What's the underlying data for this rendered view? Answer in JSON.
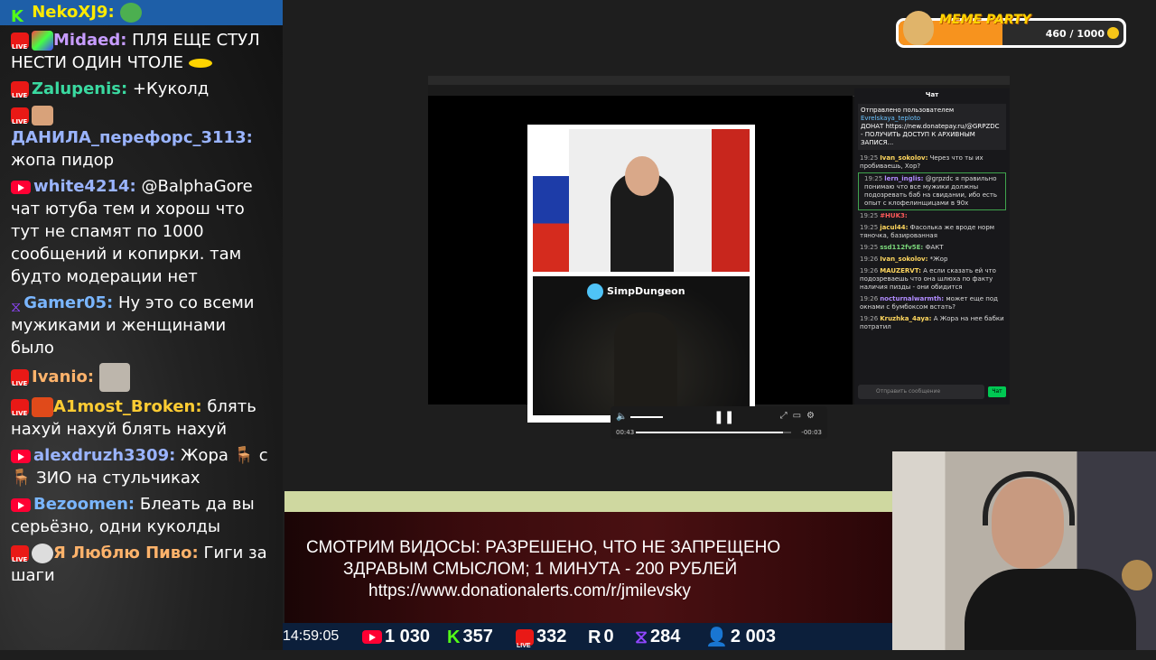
{
  "chat": {
    "top_name": "NekoXJ9:",
    "messages": [
      {
        "name": "Midaed:",
        "text": "ПЛЯ ЕЩЕ СТУЛ НЕСТИ ОДИН ЧТОЛЕ",
        "color": "#c79cff",
        "badge": "live"
      },
      {
        "name": "Zalupenis:",
        "text": "+Куколд",
        "color": "#3ad9a0",
        "badge": "live"
      },
      {
        "name": "ДАНИЛА_перефорс_3113:",
        "text": "жопа пидор",
        "color": "#9ab4ff",
        "badge": "live"
      },
      {
        "name": "white4214:",
        "text": "@BalphaGore чат ютуба тем и хорош что тут не спамят по 1000 сообщений и копирки. там будто модерации нет",
        "color": "#9ab4ff",
        "badge": "yt"
      },
      {
        "name": "Gamer05:",
        "text": "Ну это со всеми мужиками и женщинами было",
        "color": "#7ab6ff",
        "badge": "hex"
      },
      {
        "name": "Ivanio:",
        "text": "",
        "color": "#ffb36b",
        "badge": "live"
      },
      {
        "name": "A1most_Broken:",
        "text": "блять нахуй нахуй блять нахуй",
        "color": "#ffcc33",
        "badge": "live"
      },
      {
        "name": "alexdruzh3309:",
        "text": "Жора 🪑 с 🪑 ЗИО на стульчиках",
        "color": "#9ab4ff",
        "badge": "yt"
      },
      {
        "name": "Bezoomen:",
        "text": "Блеать да вы серьёзно, одни куколды",
        "color": "#7ab6ff",
        "badge": "yt"
      },
      {
        "name": "Я Люблю Пиво:",
        "text": "Гиги за шаги",
        "color": "#ffb36b",
        "badge": "live"
      }
    ]
  },
  "video": {
    "channel": "SimpDungeon",
    "time_elapsed": "00:43",
    "time_remaining": "-00:03",
    "progress": 0.95
  },
  "stream_chat": {
    "title": "Чат",
    "pinned_label": "Отправлено пользователем",
    "pinned_user": "Evrelskaya_teploto",
    "pinned_text": "ДОНАТ https://new.donatepay.ru/@GRPZDC - ПОЛУЧИТЬ ДОСТУП К АРХИВНЫМ ЗАПИСЯ...",
    "lines": [
      {
        "t": "19:25",
        "u": "Ivan_sokolov:",
        "m": "Через что ты их пробиваешь, Хор?",
        "c": "#ffd75e"
      },
      {
        "t": "19:25",
        "u": "lern_inglis:",
        "m": "@grpzdc я правильно понимаю что все мужики должны подозревать баб на свидании, ибо есть опыт с клофелинщицами в 90х",
        "c": "#b18cff",
        "hl": true
      },
      {
        "t": "19:25",
        "u": "#HUK3:",
        "m": "",
        "c": "#ff5a5a"
      },
      {
        "t": "19:25",
        "u": "jacul44:",
        "m": "Фасолька же вроде норм тяночка, базированная",
        "c": "#ffd75e"
      },
      {
        "t": "19:25",
        "u": "ssd112fv5E:",
        "m": "ФАКТ",
        "c": "#7bd87b"
      },
      {
        "t": "19:26",
        "u": "Ivan_sokolov:",
        "m": "*Жор",
        "c": "#ffd75e"
      },
      {
        "t": "19:26",
        "u": "MAUZERVT:",
        "m": "А если сказать ей что подозреваешь что она шлюха по факту наличия пизды - они обидится",
        "c": "#ffd75e"
      },
      {
        "t": "19:26",
        "u": "nocturnalwarmth:",
        "m": "может еще под окнами с бумбоксом встать?",
        "c": "#b18cff"
      },
      {
        "t": "19:26",
        "u": "Kruzhka_4aya:",
        "m": "А Жора на нее бабки потратил",
        "c": "#ffd75e"
      }
    ],
    "input_placeholder": "Отправить сообщение",
    "send_label": "Чат"
  },
  "meme_party": {
    "title": "MEME PARTY",
    "count": "460 / 1000",
    "progress": 0.46
  },
  "info": {
    "line1": "СМОТРИМ ВИДОСЫ: РАЗРЕШЕНО, ЧТО НЕ ЗАПРЕЩЕНО",
    "line2": "ЗДРАВЫМ СМЫСЛОМ; 1 МИНУТА - 200 РУБЛЕЙ",
    "line3": "https://www.donationalerts.com/r/jmilevsky"
  },
  "stats": {
    "time": "14:59:05",
    "youtube": "1 030",
    "kick": "357",
    "vk": "332",
    "rutube": "0",
    "trovo": "284",
    "total": "2 003"
  },
  "colors": {
    "youtube": "#ff0033",
    "kick": "#53fc18",
    "vk": "#e91916",
    "trovo": "#9146ff",
    "viewers": "#5aa7ff",
    "accent": "#f7931e"
  }
}
